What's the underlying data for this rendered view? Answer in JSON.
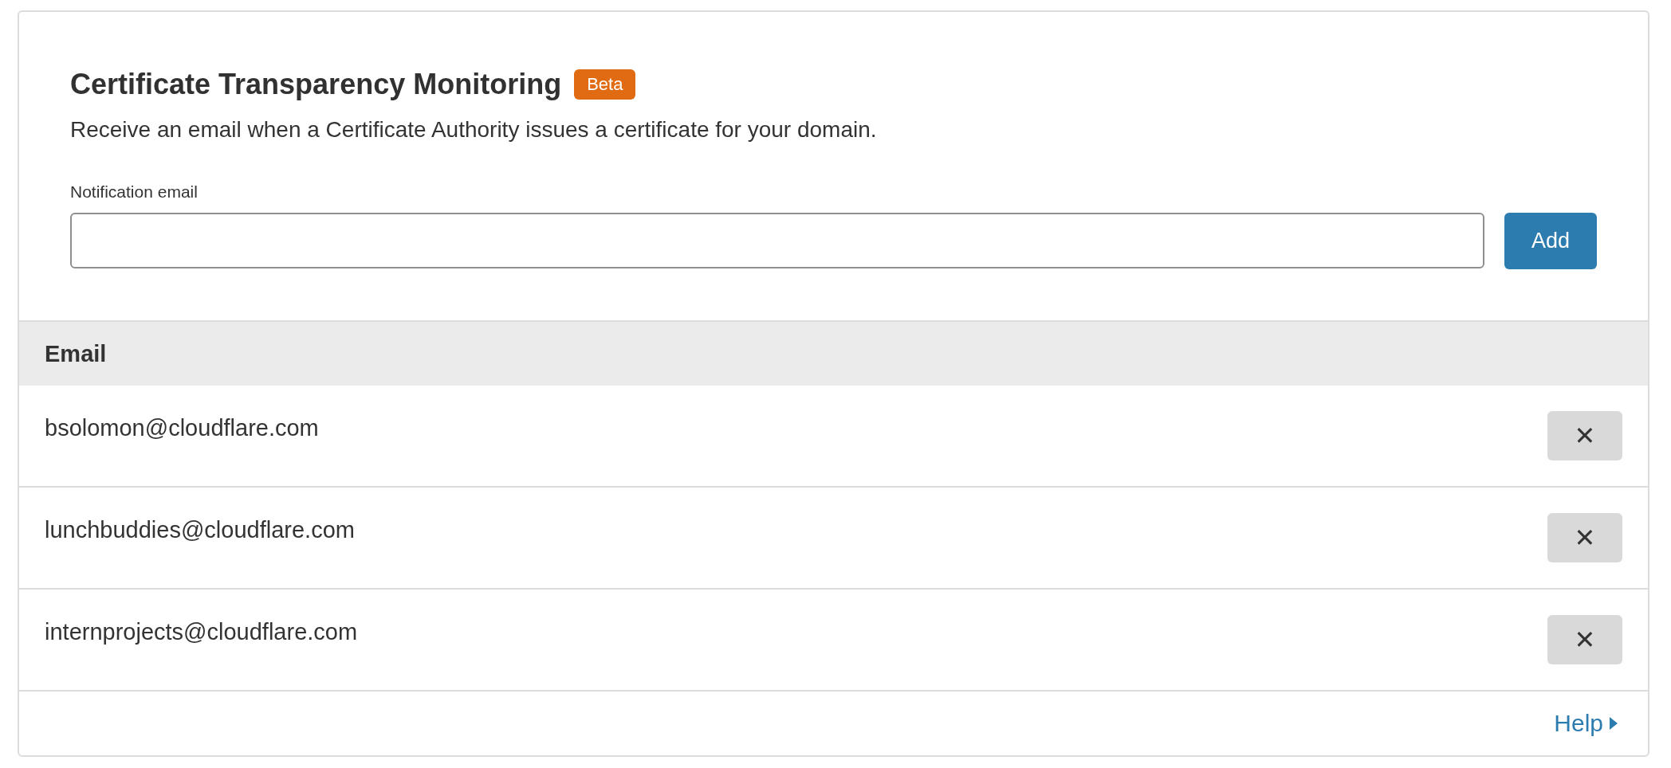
{
  "card": {
    "title": "Certificate Transparency Monitoring",
    "badge": "Beta",
    "description": "Receive an email when a Certificate Authority issues a certificate for your domain.",
    "field": {
      "label": "Notification email"
    },
    "add_button": "Add"
  },
  "table": {
    "columns": [
      "Email"
    ],
    "rows": [
      {
        "email": "bsolomon@cloudflare.com",
        "remove": "✕"
      },
      {
        "email": "lunchbuddies@cloudflare.com",
        "remove": "✕"
      },
      {
        "email": "internprojects@cloudflare.com",
        "remove": "✕"
      }
    ]
  },
  "footer": {
    "link": "Help"
  }
}
